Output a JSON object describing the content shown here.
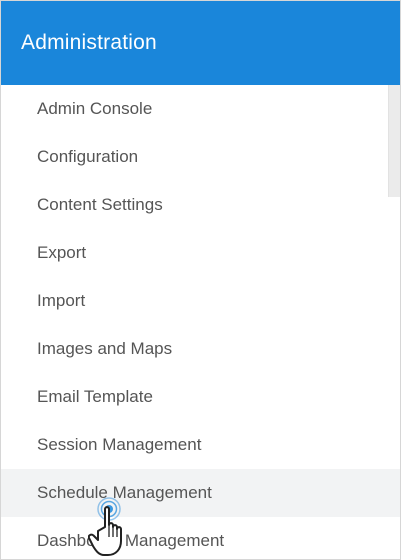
{
  "header": {
    "title": "Administration"
  },
  "menu": {
    "items": [
      {
        "label": "Admin Console"
      },
      {
        "label": "Configuration"
      },
      {
        "label": "Content Settings"
      },
      {
        "label": "Export"
      },
      {
        "label": "Import"
      },
      {
        "label": "Images and Maps"
      },
      {
        "label": "Email Template"
      },
      {
        "label": "Session Management"
      },
      {
        "label": "Schedule Management"
      },
      {
        "label": "Dashboard Management"
      }
    ],
    "hovered_item": "Schedule Management"
  },
  "colors": {
    "header_bg": "#1a86da",
    "header_text": "#ffffff",
    "item_text": "#555555",
    "hover_bg": "#f2f3f4"
  },
  "icons": {
    "cursor": "hand-pointer-icon"
  }
}
